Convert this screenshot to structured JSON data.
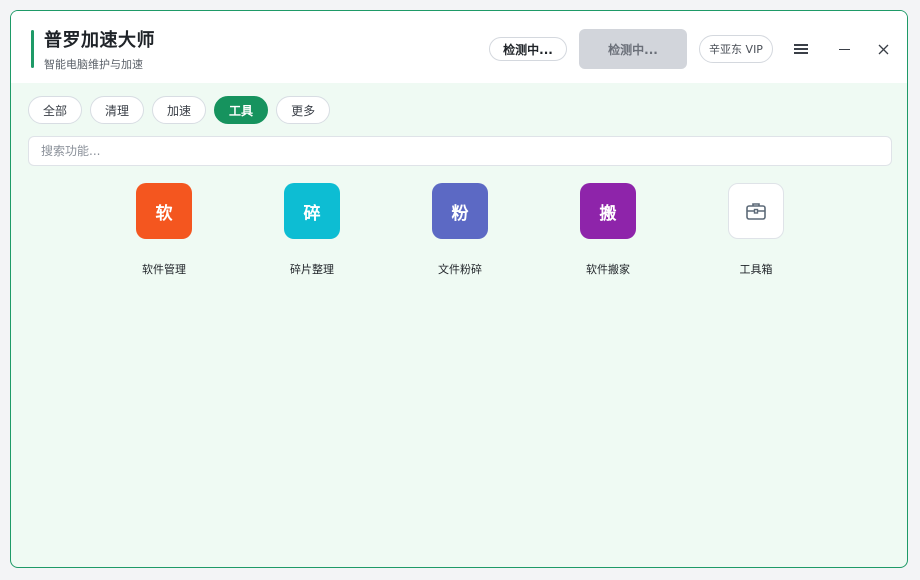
{
  "header": {
    "title": "普罗加速大师",
    "subtitle": "智能电脑维护与加速",
    "detect_button_1": "检测中...",
    "detect_button_2": "检测中...",
    "vip_label": "辛亚东 VIP"
  },
  "window_controls": {
    "menu": "menu-icon",
    "minimize": "minimize-icon",
    "close": "close-icon"
  },
  "tabs": [
    {
      "label": "全部",
      "active": false
    },
    {
      "label": "清理",
      "active": false
    },
    {
      "label": "加速",
      "active": false
    },
    {
      "label": "工具",
      "active": true
    },
    {
      "label": "更多",
      "active": false
    }
  ],
  "search": {
    "placeholder": "搜索功能...",
    "value": ""
  },
  "tools": [
    {
      "glyph": "软",
      "label": "软件管理",
      "color": "#f4561f"
    },
    {
      "glyph": "碎",
      "label": "碎片整理",
      "color": "#0dbdd3"
    },
    {
      "glyph": "粉",
      "label": "文件粉碎",
      "color": "#5c69c4"
    },
    {
      "glyph": "搬",
      "label": "软件搬家",
      "color": "#8e24aa"
    },
    {
      "glyph": "",
      "label": "工具箱",
      "color": "#ffffff",
      "icon": "toolbox-icon"
    }
  ],
  "colors": {
    "accent": "#1e9a67",
    "active_tab": "#16935e",
    "background": "#effaf3"
  }
}
